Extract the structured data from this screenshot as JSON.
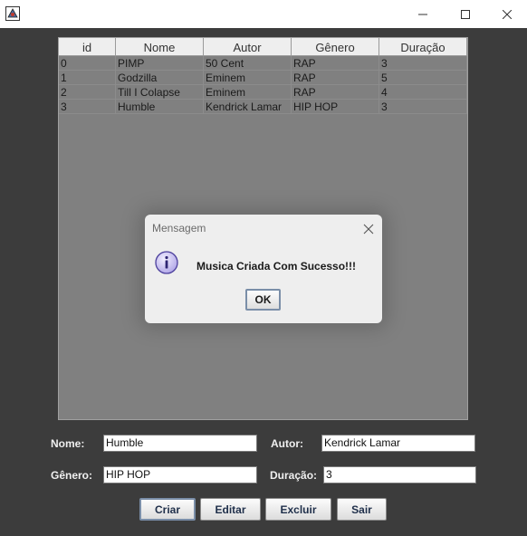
{
  "window": {
    "icon": "java-app-icon",
    "controls": [
      "minimize-icon",
      "maximize-icon",
      "close-icon"
    ]
  },
  "table": {
    "columns": [
      "id",
      "Nome",
      "Autor",
      "Gênero",
      "Duração"
    ],
    "rows": [
      [
        "0",
        "PIMP",
        "50 Cent",
        "RAP",
        "3"
      ],
      [
        "1",
        "Godzilla",
        "Eminem",
        "RAP",
        "5"
      ],
      [
        "2",
        "Till I Colapse",
        "Eminem",
        "RAP",
        "4"
      ],
      [
        "3",
        "Humble",
        "Kendrick Lamar",
        "HIP HOP",
        "3"
      ]
    ]
  },
  "dialog": {
    "title": "Mensagem",
    "message": "Musica Criada Com Sucesso!!!",
    "ok_label": "OK",
    "icon": "info-icon"
  },
  "form": {
    "nome_label": "Nome:",
    "nome_value": "Humble",
    "autor_label": "Autor:",
    "autor_value": "Kendrick Lamar",
    "genero_label": "Gênero:",
    "genero_value": "HIP HOP",
    "duracao_label": "Duração:",
    "duracao_value": "3"
  },
  "buttons": {
    "criar": "Criar",
    "editar": "Editar",
    "excluir": "Excluir",
    "sair": "Sair"
  }
}
